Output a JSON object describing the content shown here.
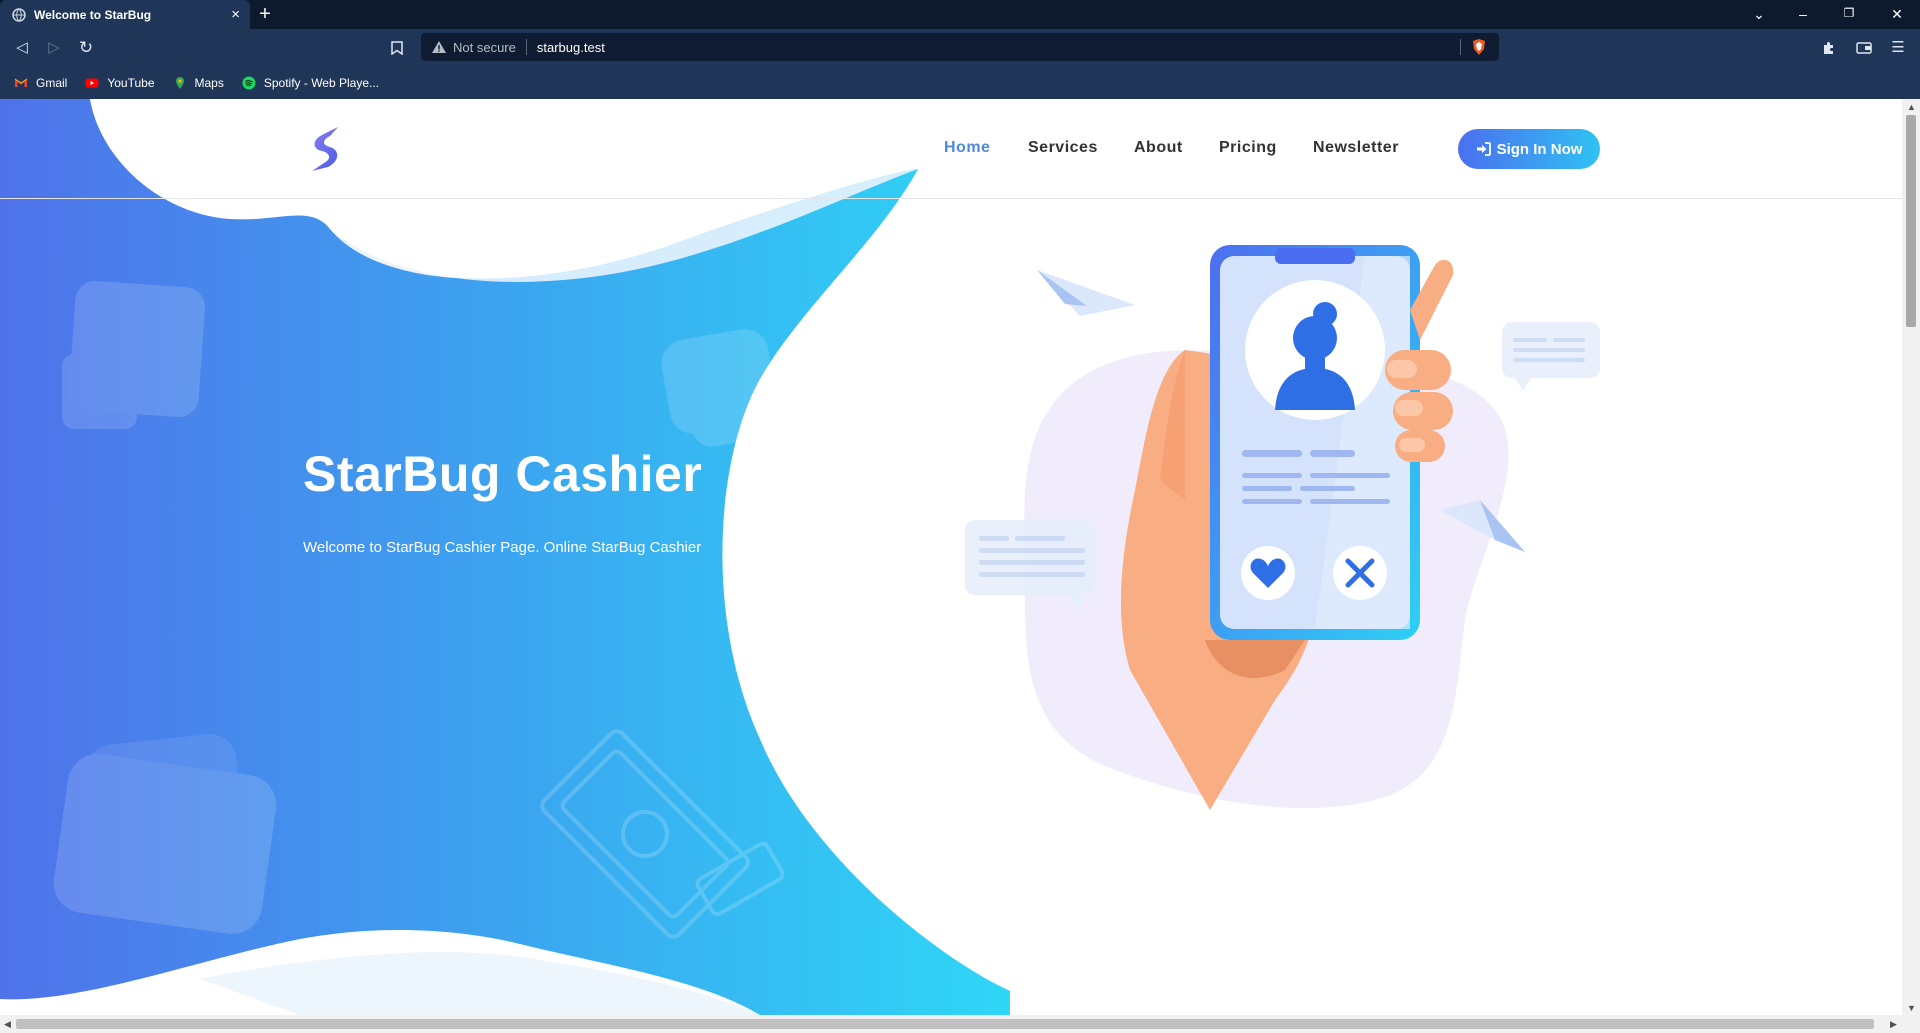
{
  "browser": {
    "tab_title": "Welcome to StarBug",
    "new_tab": "+",
    "close_tab": "×",
    "security_label": "Not secure",
    "url": "starbug.test",
    "bookmarks": [
      {
        "label": "Gmail",
        "icon": "gmail-icon"
      },
      {
        "label": "YouTube",
        "icon": "youtube-icon"
      },
      {
        "label": "Maps",
        "icon": "maps-icon"
      },
      {
        "label": "Spotify - Web Playe...",
        "icon": "spotify-icon"
      }
    ]
  },
  "site": {
    "nav": [
      {
        "label": "Home",
        "active": true
      },
      {
        "label": "Services",
        "active": false
      },
      {
        "label": "About",
        "active": false
      },
      {
        "label": "Pricing",
        "active": false
      },
      {
        "label": "Newsletter",
        "active": false
      }
    ],
    "signin_label": "Sign In Now",
    "hero_title": "StarBug Cashier",
    "hero_subtitle": "Welcome to StarBug Cashier Page. Online StarBug Cashier"
  },
  "colors": {
    "brand_gradient_start": "#4f6fe8",
    "brand_gradient_end": "#2fd2f5",
    "nav_active": "#4b8bd9",
    "chrome_bg": "#1f3658"
  }
}
